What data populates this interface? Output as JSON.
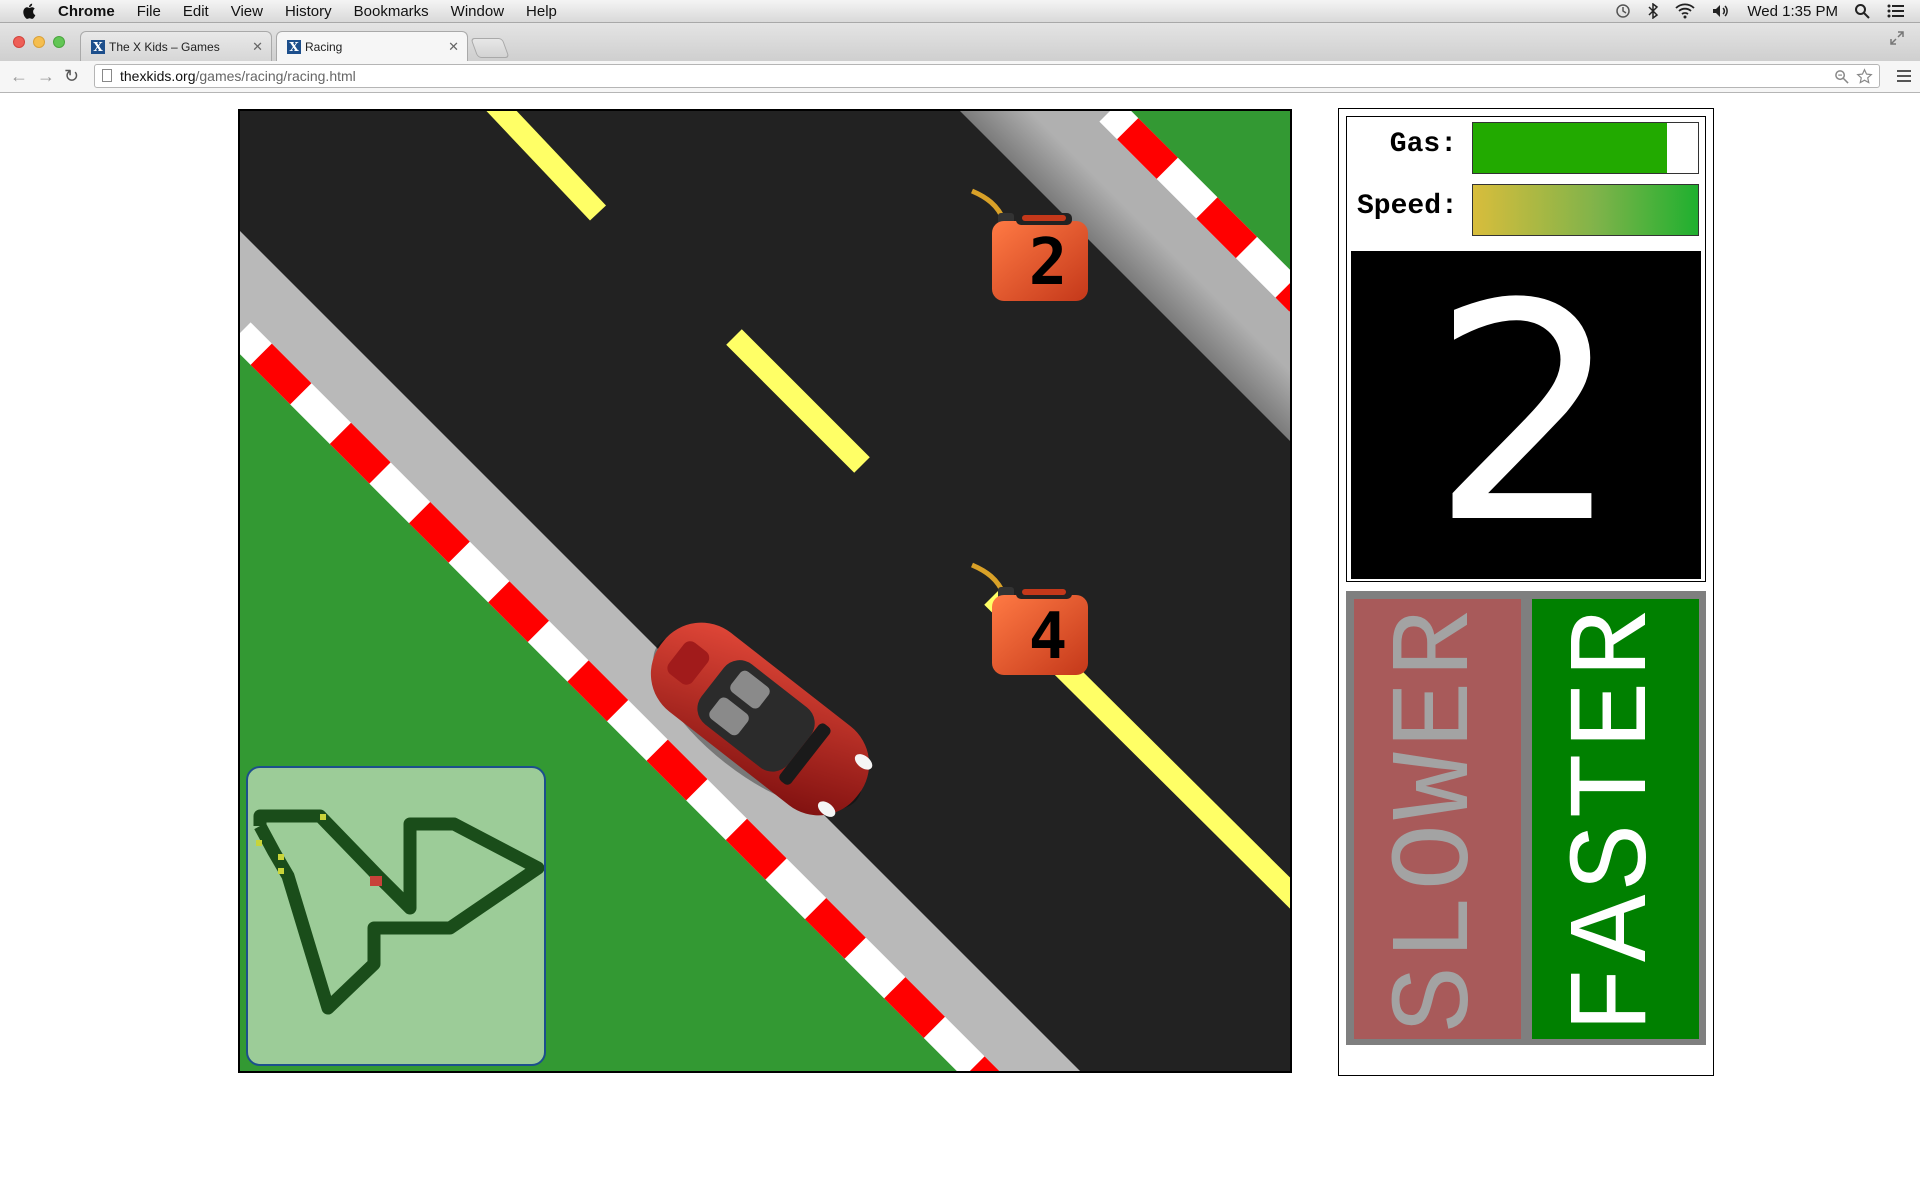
{
  "menubar": {
    "app": "Chrome",
    "items": [
      "File",
      "Edit",
      "View",
      "History",
      "Bookmarks",
      "Window",
      "Help"
    ],
    "clock": "Wed 1:35 PM"
  },
  "tabs": [
    {
      "title": "The X Kids – Games",
      "favicon": "X"
    },
    {
      "title": "Racing",
      "favicon": "X"
    }
  ],
  "address": {
    "host": "thexkids.org",
    "path": "/games/racing/racing.html"
  },
  "game": {
    "gas_cans": [
      {
        "label": "2"
      },
      {
        "label": "4"
      }
    ],
    "minimap_icon": "track-minimap"
  },
  "panel": {
    "gas_label": "Gas:",
    "gas_level": 0.86,
    "speed_label": "Speed:",
    "speed_level": 1.0,
    "countdown": "2",
    "slower_label": "SLOWER",
    "faster_label": "FASTER"
  },
  "colors": {
    "grass": "#339933",
    "road": "#222222",
    "slower_bg": "#a85a5a",
    "slower_text": "#a0a0a0",
    "faster_bg": "#008000",
    "faster_text": "#ffffff",
    "gas_fill": "#22aa00"
  }
}
